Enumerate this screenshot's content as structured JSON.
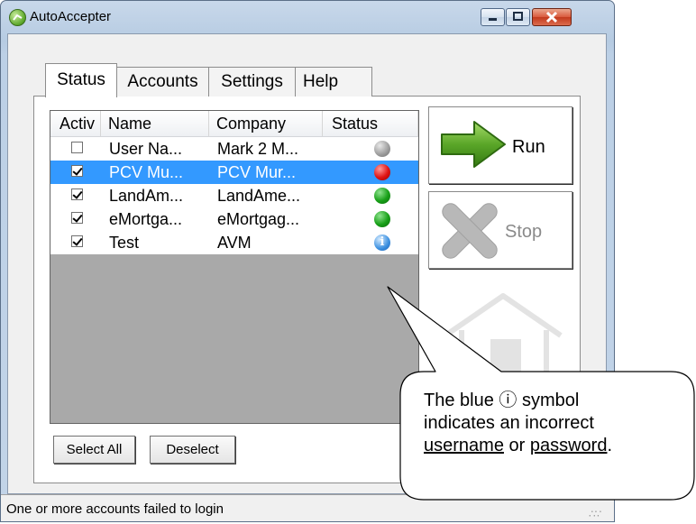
{
  "window": {
    "title": "AutoAccepter"
  },
  "tabs": [
    {
      "label": "Status",
      "active": true
    },
    {
      "label": "Accounts",
      "active": false
    },
    {
      "label": "Settings",
      "active": false
    },
    {
      "label": "Help",
      "active": false
    }
  ],
  "list": {
    "columns": [
      "Activ",
      "Name",
      "Company",
      "Status"
    ],
    "rows": [
      {
        "active": false,
        "name": "User Na...",
        "company": "Mark 2 M...",
        "status": "gray",
        "selected": false
      },
      {
        "active": true,
        "name": "PCV Mu...",
        "company": "PCV Mur...",
        "status": "red",
        "selected": true
      },
      {
        "active": true,
        "name": "LandAm...",
        "company": "LandAme...",
        "status": "green",
        "selected": false
      },
      {
        "active": true,
        "name": "eMortga...",
        "company": "eMortgag...",
        "status": "green",
        "selected": false
      },
      {
        "active": true,
        "name": "Test",
        "company": "AVM",
        "status": "info",
        "selected": false
      }
    ]
  },
  "buttons": {
    "select_all": "Select All",
    "deselect": "Deselect",
    "run": "Run",
    "stop": "Stop"
  },
  "statusbar": {
    "text": "One or more accounts failed to login"
  },
  "callout": {
    "line1": "The blue ⓘ  symbol",
    "line2": "indicates an incorrect",
    "word_username": "username",
    "word_or": "or",
    "word_password": "password",
    "period": "."
  },
  "colors": {
    "selection": "#3399ff",
    "status_red": "#e01515",
    "status_green": "#18a018",
    "status_gray": "#9a9a9a",
    "status_info": "#3a8fe0",
    "run_arrow": "#5aa628"
  },
  "icons": [
    "app-icon",
    "minimize-icon",
    "maximize-icon",
    "close-icon",
    "run-arrow-icon",
    "stop-x-icon",
    "house-icon",
    "info-icon",
    "resize-grip-icon"
  ]
}
